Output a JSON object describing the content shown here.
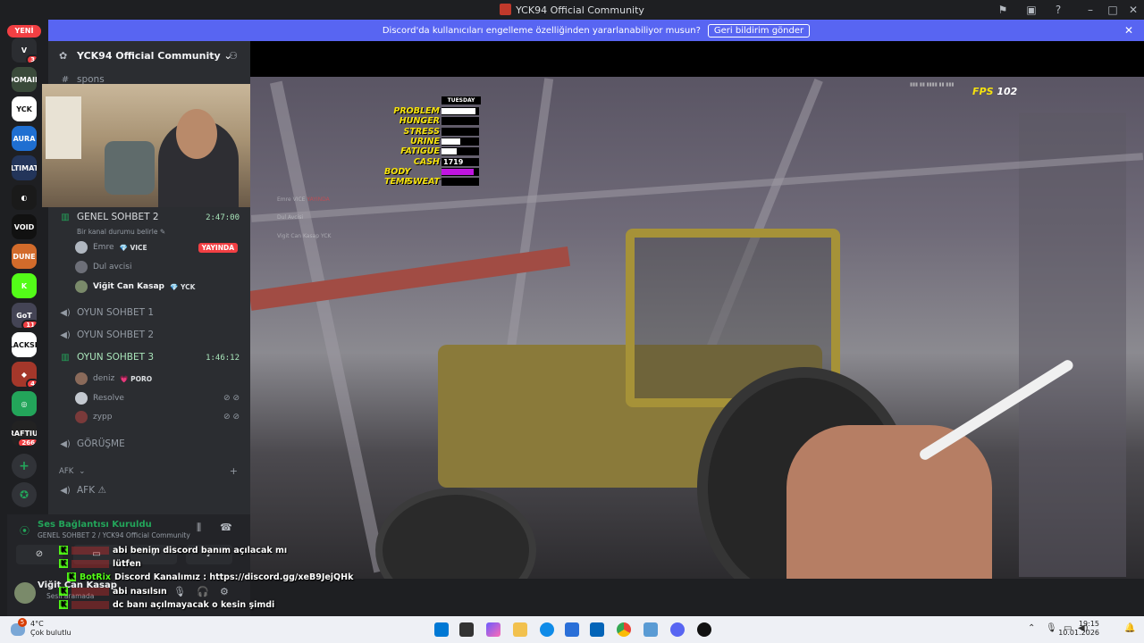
{
  "window": {
    "title": "YCK94 Official Community"
  },
  "notice": {
    "text": "Discord'da kullanıcıları engelleme özelliğinden yararlanabiliyor musun?",
    "button": "Geri bildirim gönder",
    "close": "✕"
  },
  "rail": {
    "new_badge": "YENİ",
    "servers": [
      {
        "label": "V",
        "badge": "3",
        "color": "#2b2d31"
      },
      {
        "label": "DOMAIN",
        "badge": "",
        "color": "#3a4a3a"
      },
      {
        "label": "YCK",
        "badge": "",
        "color": "#ffffff"
      },
      {
        "label": "AURA",
        "badge": "",
        "color": "#1f6fd1"
      },
      {
        "label": "ULTIMATE",
        "badge": "",
        "color": "#23355a"
      },
      {
        "label": "◐",
        "badge": "",
        "color": "#1a1a1a"
      },
      {
        "label": "VOID",
        "badge": "",
        "color": "#111111"
      },
      {
        "label": "DUNE",
        "badge": "",
        "color": "#d26b2b"
      },
      {
        "label": "K",
        "badge": "",
        "color": "#53fc18"
      },
      {
        "label": "GoT",
        "badge": "11",
        "color": "#444455"
      },
      {
        "label": "BLACKSEA",
        "badge": "",
        "color": "#ffffff"
      },
      {
        "label": "◆",
        "badge": "4",
        "color": "#a4372a"
      },
      {
        "label": "◎",
        "badge": "",
        "color": "#23a55a"
      },
      {
        "label": "KRAFTIUM",
        "badge": "266",
        "color": "#222222"
      }
    ]
  },
  "sidebar": {
    "server_name": "YCK94 Official Community",
    "top_channel": "spons",
    "channels": {
      "genel2": {
        "name": "GENEL SOHBET 2",
        "time": "2:47:00",
        "status": "Bir kanal durumu belirle ✎"
      },
      "oyun1": "OYUN SOHBET 1",
      "oyun2": "OYUN SOHBET 2",
      "oyun3": {
        "name": "OYUN SOHBET 3",
        "time": "1:46:12"
      },
      "gorusme": "GÖRÜŞME",
      "afk_category": "AFK",
      "afk": "AFK ⚠"
    },
    "genel2_users": [
      {
        "name": "Emre",
        "tag": "💎 VICE",
        "live": "YAYINDA"
      },
      {
        "name": "Dul avcisi",
        "tag": ""
      },
      {
        "name": "Viğit Can Kasap",
        "tag": "💎 YCK"
      }
    ],
    "oyun3_users": [
      {
        "name": "deniz",
        "tag": "💗 PORO"
      },
      {
        "name": "Resolve",
        "tag": ""
      },
      {
        "name": "zypp",
        "tag": ""
      }
    ]
  },
  "voice": {
    "status": "Ses Bağlantısı Kuruldu",
    "channel": "GENEL SOHBET 2 / YCK94 Official Community",
    "user_name": "Viğit Can Kasap",
    "user_status": "Sesli aramada"
  },
  "hud": {
    "day": "TUESDAY",
    "rows": [
      {
        "label": "PROBLEM",
        "fill": 0.9,
        "color": "#ffffff"
      },
      {
        "label": "HUNGER",
        "fill": 0.0,
        "color": "#ffffff"
      },
      {
        "label": "STRESS",
        "fill": 0.0,
        "color": "#ffffff"
      },
      {
        "label": "URINE",
        "fill": 0.5,
        "color": "#ffffff"
      },
      {
        "label": "FATIGUE",
        "fill": 0.4,
        "color": "#ffffff"
      },
      {
        "label": "CASH",
        "value": "1719"
      },
      {
        "label": "BODY TEMP",
        "fill": 0.85,
        "color": "#c014e0"
      },
      {
        "label": "SWEAT",
        "fill": 0.0,
        "color": "#ffffff"
      }
    ],
    "fps_label": "FPS",
    "fps_value": "102"
  },
  "stream_overlay": [
    {
      "name": "Emre",
      "tag": "VICE",
      "live": "YAYINDA"
    },
    {
      "name": "Dul Avcisi",
      "tag": "",
      "live": ""
    },
    {
      "name": "Vigit Can Kasap",
      "tag": "YCK",
      "live": ""
    }
  ],
  "chat": [
    {
      "name": "",
      "text": "abi benim discord banım açılacak mı"
    },
    {
      "name": "",
      "text": "lütfen"
    },
    {
      "name": "BotRix",
      "text": "Discord Kanalımız : https://discord.gg/xeB9JejQHk"
    },
    {
      "name": "",
      "text": "abi nasılsın"
    },
    {
      "name": "",
      "text": "dc banı açılmayacak o kesin şimdi"
    }
  ],
  "taskbar": {
    "weather_temp": "4°C",
    "weather_desc": "Çok bulutlu",
    "weather_badge": "5",
    "time": "19:15",
    "date": "10.01.2026"
  }
}
